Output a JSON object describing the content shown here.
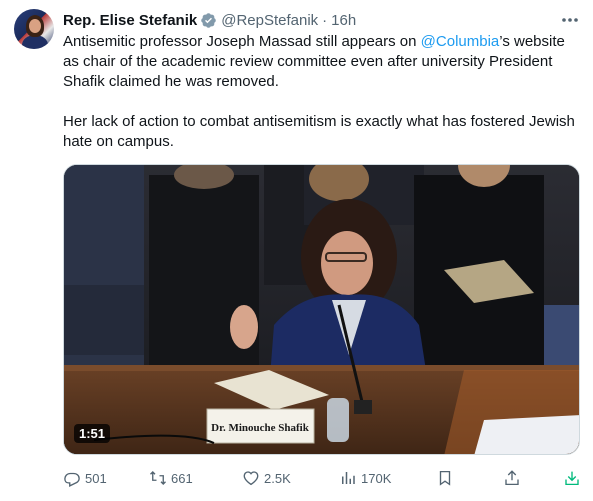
{
  "author": {
    "name": "Rep. Elise Stefanik",
    "handle": "@RepStefanik",
    "separator": "·",
    "time": "16h"
  },
  "tweet": {
    "para1_a": "Antisemitic professor Joseph Massad still appears on ",
    "para1_mention": "@Columbia",
    "para1_b": "’s website as chair of the academic review committee even after university President Shafik claimed he was removed.",
    "para2": "Her lack of action to combat antisemitism is exactly what has fostered Jewish hate on campus."
  },
  "media": {
    "duration": "1:51",
    "nameplate": "Dr. Minouche Shafik"
  },
  "actions": {
    "replies": "501",
    "retweets": "661",
    "likes": "2.5K",
    "views": "170K"
  },
  "icons": [
    "verified-badge-icon",
    "more-icon",
    "reply-icon",
    "retweet-icon",
    "like-icon",
    "views-icon",
    "bookmark-icon",
    "share-icon",
    "download-icon"
  ],
  "colors": {
    "accent": "#1d9bf0",
    "secondary_text": "#536471",
    "download": "#00ba7c"
  }
}
